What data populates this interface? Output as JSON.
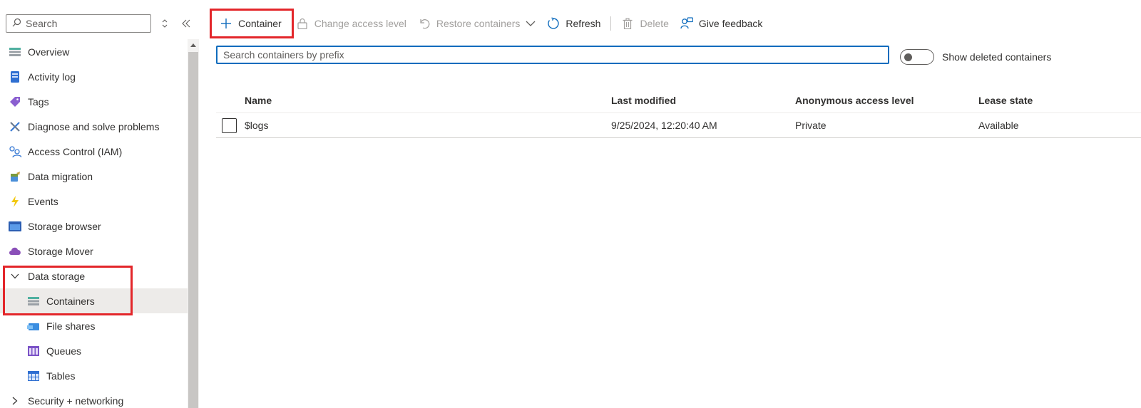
{
  "sidebar": {
    "search_placeholder": "Search",
    "items": [
      {
        "label": "Overview",
        "icon": "overview-icon"
      },
      {
        "label": "Activity log",
        "icon": "activity-log-icon"
      },
      {
        "label": "Tags",
        "icon": "tag-icon"
      },
      {
        "label": "Diagnose and solve problems",
        "icon": "wrench-icon"
      },
      {
        "label": "Access Control (IAM)",
        "icon": "people-icon"
      },
      {
        "label": "Data migration",
        "icon": "data-migration-icon"
      },
      {
        "label": "Events",
        "icon": "lightning-icon"
      },
      {
        "label": "Storage browser",
        "icon": "storage-browser-icon"
      },
      {
        "label": "Storage Mover",
        "icon": "cloud-icon"
      }
    ],
    "group": {
      "label": "Data storage",
      "expanded": true
    },
    "sub_items": [
      {
        "label": "Containers",
        "icon": "containers-icon",
        "active": true
      },
      {
        "label": "File shares",
        "icon": "file-shares-icon"
      },
      {
        "label": "Queues",
        "icon": "queues-icon"
      },
      {
        "label": "Tables",
        "icon": "tables-icon"
      }
    ],
    "collapsed_group": {
      "label": "Security + networking",
      "expanded": false
    }
  },
  "toolbar": {
    "container_label": "Container",
    "change_access_label": "Change access level",
    "restore_label": "Restore containers",
    "refresh_label": "Refresh",
    "delete_label": "Delete",
    "feedback_label": "Give feedback"
  },
  "main": {
    "filter_placeholder": "Search containers by prefix",
    "show_deleted_label": "Show deleted containers",
    "show_deleted_on": false,
    "columns": [
      "Name",
      "Last modified",
      "Anonymous access level",
      "Lease state"
    ],
    "rows": [
      {
        "name": "$logs",
        "last_modified": "9/25/2024, 12:20:40 AM",
        "access_level": "Private",
        "lease_state": "Available"
      }
    ]
  },
  "colors": {
    "accent": "#0f6cbd",
    "highlight": "#e3262a",
    "active_bg": "#edebe9"
  }
}
